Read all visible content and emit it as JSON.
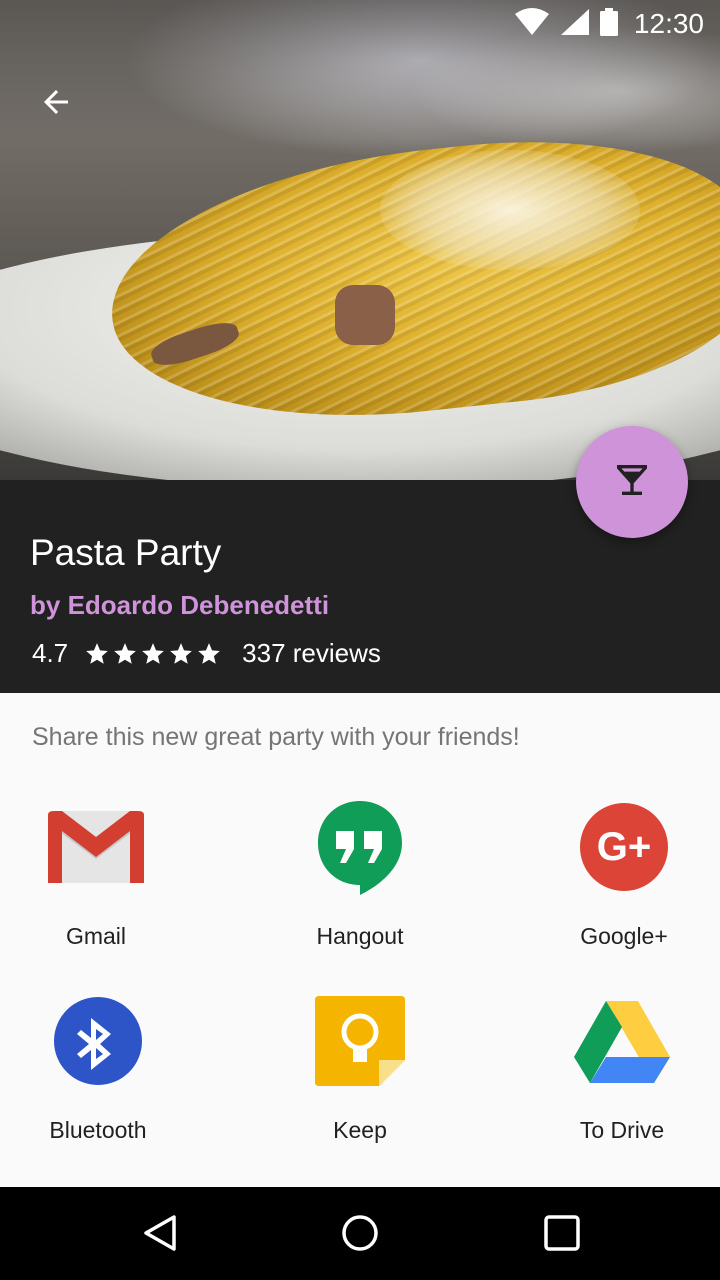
{
  "status_bar": {
    "time": "12:30",
    "icons": [
      "wifi-icon",
      "signal-icon",
      "battery-icon"
    ]
  },
  "app_bar": {
    "back_icon": "arrow-left-icon"
  },
  "recipe": {
    "title": "Pasta Party",
    "author": "by Edoardo Debenedetti",
    "rating": "4.7",
    "stars": 5,
    "reviews": "337 reviews",
    "fab_icon": "cocktail-glass-icon"
  },
  "share": {
    "prompt": "Share this new great party with your friends!",
    "targets": [
      {
        "label": "Gmail",
        "icon": "gmail-icon"
      },
      {
        "label": "Hangout",
        "icon": "hangouts-icon"
      },
      {
        "label": "Google+",
        "icon": "google-plus-icon"
      },
      {
        "label": "Bluetooth",
        "icon": "bluetooth-icon"
      },
      {
        "label": "Keep",
        "icon": "keep-icon"
      },
      {
        "label": "To Drive",
        "icon": "drive-icon"
      }
    ]
  },
  "nav_bar": {
    "icons": [
      "back-triangle-icon",
      "home-circle-icon",
      "recents-square-icon"
    ]
  },
  "colors": {
    "accent": "#ce93d8",
    "panel": "#212121",
    "sheet": "#fafafa",
    "prompt_text": "#757575"
  }
}
